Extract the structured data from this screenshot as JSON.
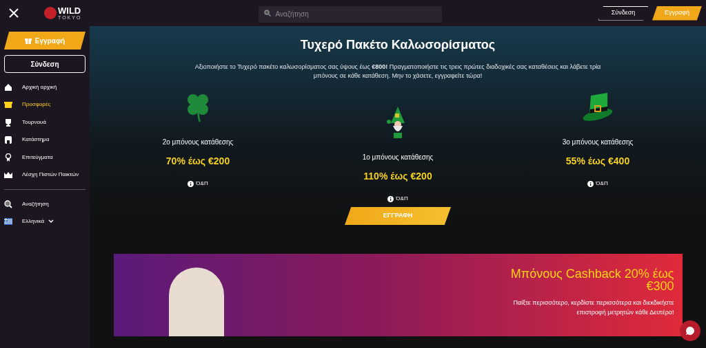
{
  "header": {
    "logo_text": "WILD",
    "logo_subtext": "TOKYO",
    "search": {
      "placeholder": "Αναζήτηση"
    },
    "login": "Σύνδεση",
    "register": "Εγγραφή"
  },
  "sidebar": {
    "register": "Εγγραφή",
    "login": "Σύνδεση",
    "items": [
      {
        "label": "Αρχική αρχική",
        "selected": false
      },
      {
        "label": "Προσφορές",
        "selected": true
      },
      {
        "label": "Τουρνουά",
        "selected": false
      },
      {
        "label": "Κατάστημα",
        "selected": false
      },
      {
        "label": "Επιτεύγματα",
        "selected": false
      },
      {
        "label": "Λέσχη Πιστών Παικτών",
        "selected": false
      }
    ],
    "search": "Αναζήτηση",
    "language": "Ελληνικά"
  },
  "welcome": {
    "title": "Τυχερό Πακέτο Καλωσορίσματος",
    "text": "Αξιοποιήστε το Τυχερό πακέτο καλωσορίσματος σας ύψους έως **€800!** Πραγματοποιήστε τις τρεις πρώτες διαδοχικές σας καταθέσεις και λάβετε τρία μπόνους σε κάθε κατάθεση. Μην το χάσετε, εγγραφείτε τώρα!",
    "bonuses": [
      {
        "label": "2ο μπόνους κατάθεσης",
        "amount": "70% έως €200",
        "terms": "Ό&Π"
      },
      {
        "label": "1ο μπόνους κατάθεσης",
        "amount": "110% έως €200",
        "terms": "Ό&Π"
      },
      {
        "label": "3ο μπόνους κατάθεσης",
        "amount": "55% έως €400",
        "terms": "Ό&Π"
      }
    ],
    "button": "ΕΓΓΡΑΦΗ"
  },
  "cashback": {
    "title": "Μπόνους Cashback 20% έως €300",
    "text": "Παίξτε περισσότερο, κερδίστε περισσότερα και διεκδικήστε επιστροφή μετρητών κάθε Δευτέρα!"
  }
}
